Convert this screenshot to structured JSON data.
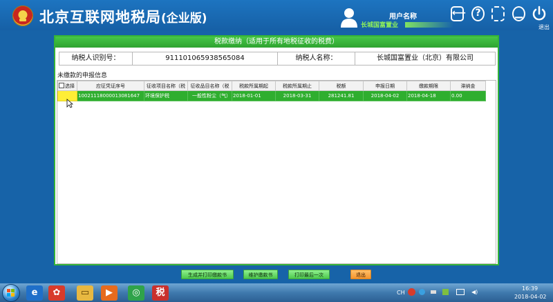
{
  "header": {
    "title": "北京互联网地税局",
    "edition": "(企业版)",
    "user_label": "用户名称",
    "company": "长城国富置业",
    "exit_label": "退出",
    "icons": [
      "back-icon",
      "help-icon",
      "fullscreen-icon",
      "power-icon"
    ]
  },
  "panel": {
    "title": "税款缴纳（适用于所有地税征收的税费）",
    "taxpayer_id_label": "纳税人识别号：",
    "taxpayer_id": "911101065938565084",
    "taxpayer_name_label": "纳税人名称：",
    "taxpayer_name": "长城国富置业（北京）有限公司",
    "section_label": "未缴款的申报信息"
  },
  "table": {
    "columns": [
      "选择",
      "应征凭证序号",
      "征收项目名称（税",
      "征收品目名称（税",
      "税款所属期起",
      "税款所属期止",
      "税额",
      "申报日期",
      "缴款期限",
      "滞纳金"
    ],
    "rows": [
      [
        "",
        "10021118000013081647",
        "环境保护税",
        "一般性粉尘（气）",
        "2018-01-01",
        "2018-03-31",
        "281241.81",
        "2018-04-02",
        "2018-04-18",
        "0.00"
      ]
    ]
  },
  "buttons": {
    "generate_print": "生成并打印缴款书",
    "maintain": "维护缴款书",
    "print_last": "打印最后一次",
    "exit": "退出"
  },
  "taskbar": {
    "time": "16:39",
    "date": "2018-04-02"
  },
  "colors": {
    "background": "#1763a8",
    "panel_green": "#35b237",
    "row_green": "#2fae2f",
    "exit_orange": "#f5952d"
  }
}
